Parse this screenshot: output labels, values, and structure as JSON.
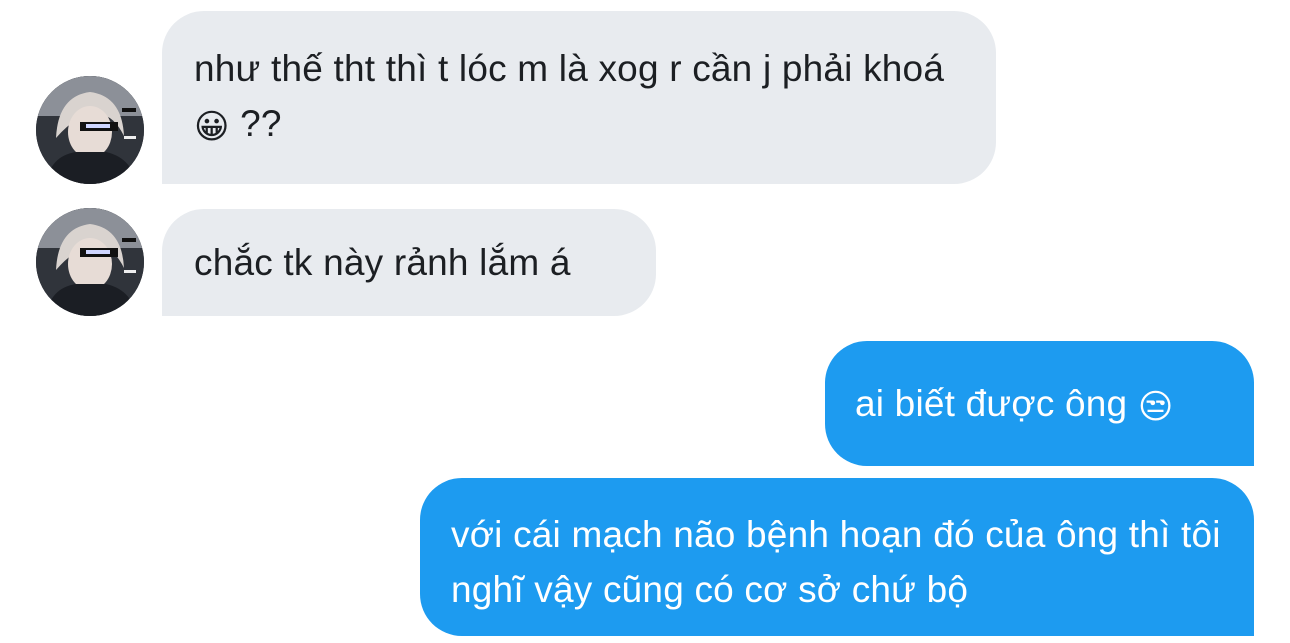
{
  "messages": [
    {
      "side": "incoming",
      "text": "như thế tht thì t lóc m là xog r cần j phải khoá",
      "emoji": "😀",
      "suffix": " ??"
    },
    {
      "side": "incoming",
      "text": "chắc tk này rảnh lắm á"
    },
    {
      "side": "outgoing",
      "text": "ai biết được ông",
      "emoji": "😒"
    },
    {
      "side": "outgoing",
      "text": "với cái mạch não bệnh hoạn đó của ông thì tôi nghĩ vậy cũng có cơ sở chứ bộ"
    }
  ],
  "colors": {
    "incoming_bubble": "#e8ebef",
    "outgoing_bubble": "#1d9bf0",
    "incoming_text": "#1c1f23",
    "outgoing_text": "#ffffff"
  },
  "icons": {
    "avatar": "anime-character-avatar",
    "emoji_1": "grinning-face-emoji",
    "emoji_2": "unamused-face-emoji"
  }
}
